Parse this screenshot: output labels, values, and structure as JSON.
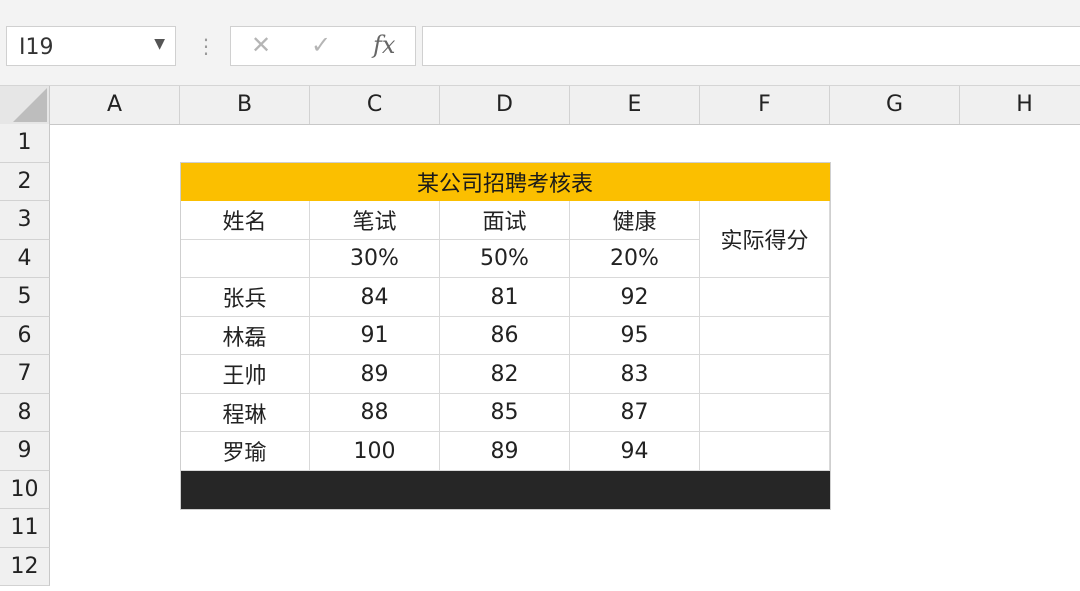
{
  "formula_bar": {
    "name_box": "I19",
    "cancel_glyph": "✕",
    "enter_glyph": "✓",
    "fx_label": "fx",
    "formula_value": ""
  },
  "icons": {
    "name_box_dropdown": "chevron-down-icon",
    "cancel": "close-icon",
    "enter": "check-icon",
    "function": "fx-icon"
  },
  "columns": [
    "A",
    "B",
    "C",
    "D",
    "E",
    "F",
    "G",
    "H"
  ],
  "rows": [
    "1",
    "2",
    "3",
    "4",
    "5",
    "6",
    "7",
    "8",
    "9",
    "10",
    "11",
    "12"
  ],
  "sheet": {
    "title": "某公司招聘考核表",
    "headers": [
      "姓名",
      "笔试",
      "面试",
      "健康"
    ],
    "weights": [
      "30%",
      "50%",
      "20%"
    ],
    "score_header": "实际得分",
    "records": [
      [
        "张兵",
        "84",
        "81",
        "92"
      ],
      [
        "林磊",
        "91",
        "86",
        "95"
      ],
      [
        "王帅",
        "89",
        "82",
        "83"
      ],
      [
        "程琳",
        "88",
        "85",
        "87"
      ],
      [
        "罗瑜",
        "100",
        "89",
        "94"
      ]
    ]
  },
  "colors": {
    "title_fill": "#fbbf00",
    "footer_fill": "#262626",
    "grid_line": "#d9d9d9",
    "header_bg": "#f0f0f0"
  }
}
